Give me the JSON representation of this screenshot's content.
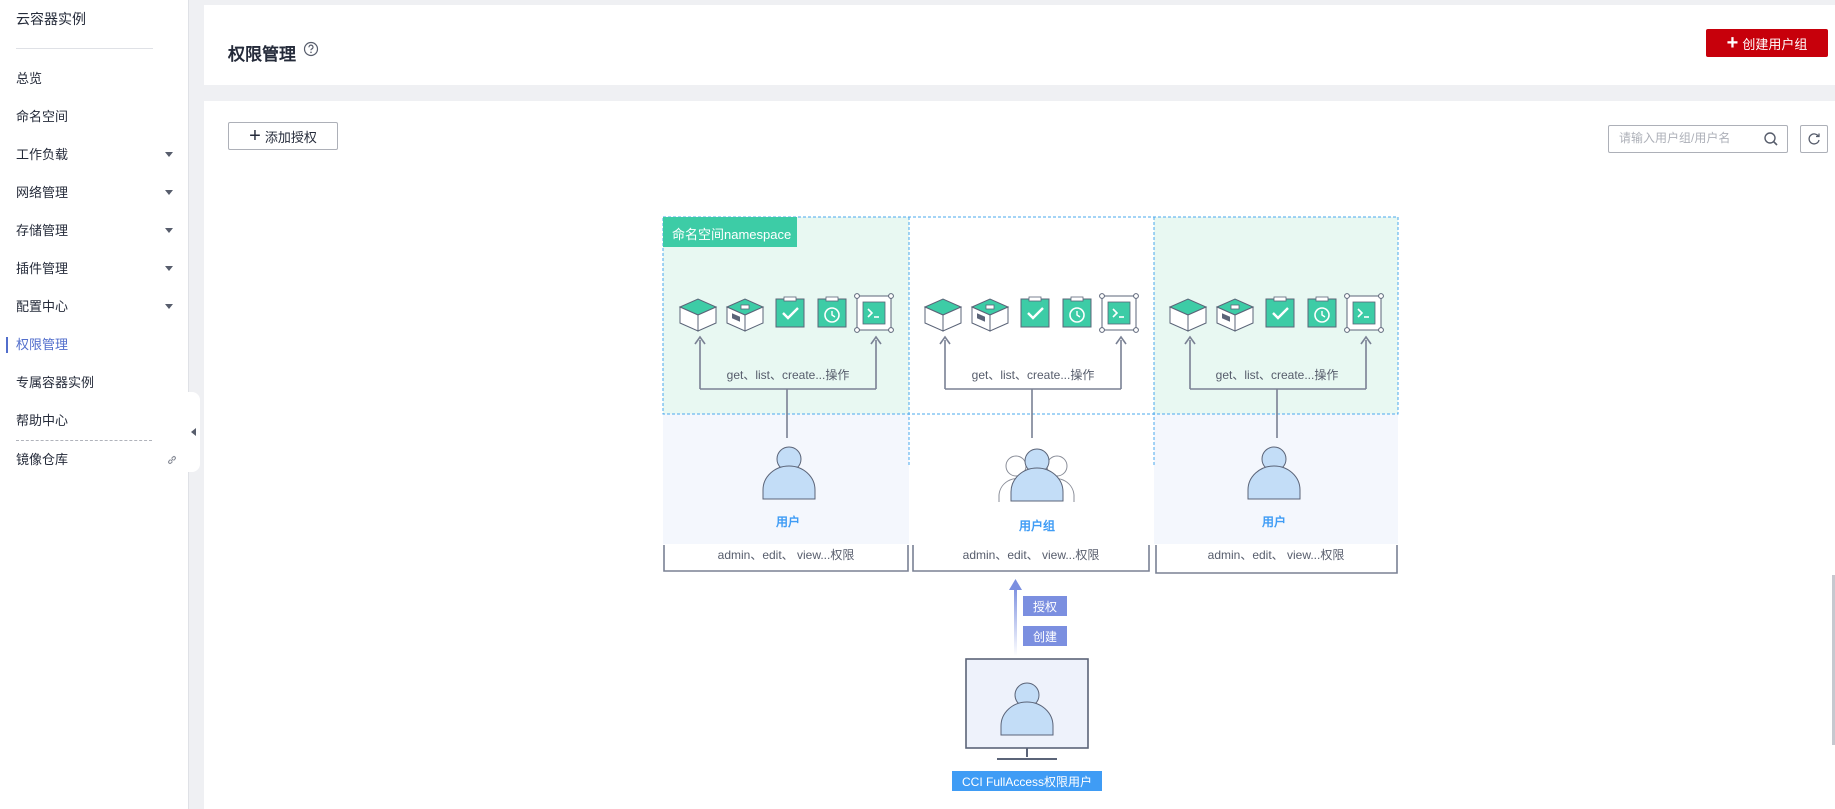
{
  "sidebar": {
    "title": "云容器实例",
    "items": [
      {
        "label": "总览",
        "has_caret": false
      },
      {
        "label": "命名空间",
        "has_caret": false
      },
      {
        "label": "工作负载",
        "has_caret": true
      },
      {
        "label": "网络管理",
        "has_caret": true
      },
      {
        "label": "存储管理",
        "has_caret": true
      },
      {
        "label": "插件管理",
        "has_caret": true
      },
      {
        "label": "配置中心",
        "has_caret": true
      },
      {
        "label": "权限管理",
        "active": true
      },
      {
        "label": "专属容器实例"
      },
      {
        "label": "帮助中心"
      },
      {
        "label": "镜像仓库",
        "icon": "external-link-icon"
      }
    ]
  },
  "header": {
    "title": "权限管理",
    "help_icon": "question-circle-icon",
    "create_button": "创建用户组"
  },
  "toolbar": {
    "add_button": "添加授权",
    "search_placeholder": "请输入用户组/用户名",
    "search_icon": "search-icon",
    "refresh_icon": "refresh-icon"
  },
  "diagram": {
    "namespace_tag": "命名空间namespace",
    "operations_label": "get、list、create...操作",
    "permissions_label": "admin、edit、 view...权限",
    "columns": [
      {
        "role": "用户"
      },
      {
        "role": "用户组"
      },
      {
        "role": "用户"
      }
    ],
    "resource_icons": [
      "cube-icon",
      "box-icon",
      "check-task-icon",
      "clock-task-icon",
      "terminal-icon"
    ],
    "authorize_label": "授权",
    "create_label": "创建",
    "admin_label": "CCI FullAccess权限用户"
  },
  "colors": {
    "brand_red": "#c7000b",
    "accent_blue": "#526ecc",
    "namespace_green": "#3dcca6",
    "user_fill": "#c3ddf7",
    "arrow_purple": "#7b8fe0",
    "admin_blue": "#3f9cf5"
  }
}
